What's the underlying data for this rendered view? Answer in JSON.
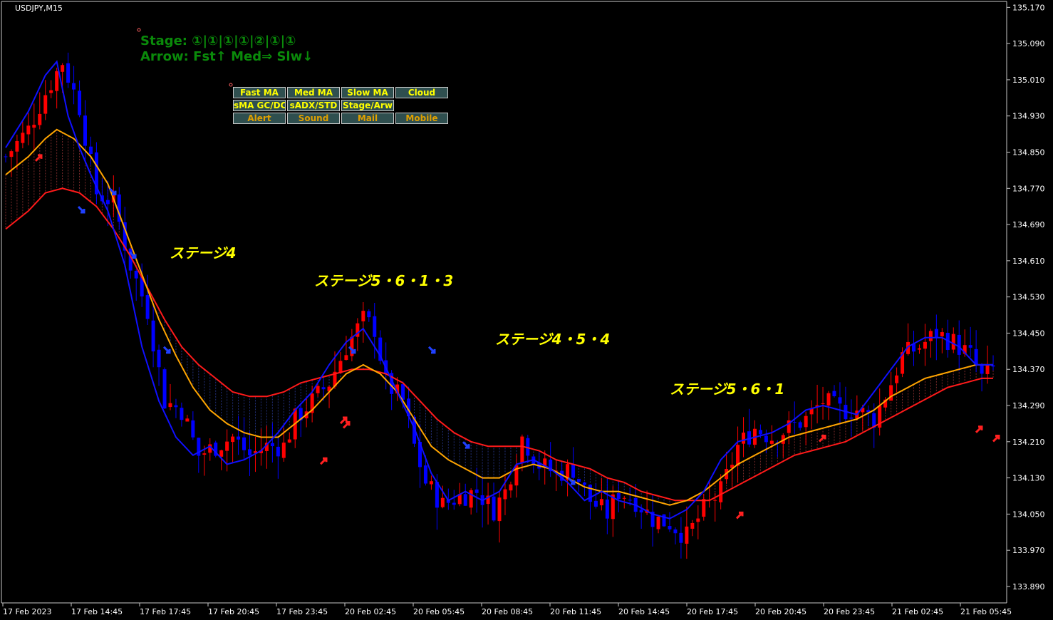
{
  "symbol_label": "USDJPY,M15",
  "status": {
    "stage_line": "Stage: ①|①|①|①|②|①|①",
    "arrow_line": "Arrow: Fst↑ Med⇒ Slw↓"
  },
  "buttons": {
    "row1": [
      "Fast MA",
      "Med MA",
      "Slow MA",
      "Cloud"
    ],
    "row2": [
      "sMA GC/DC",
      "sADX/STD",
      "Stage/Arw"
    ],
    "row3": [
      "Alert",
      "Sound",
      "Mail",
      "Mobile"
    ]
  },
  "annotations": [
    "ステージ4",
    "ステージ5・6・1・3",
    "ステージ4・5・4",
    "ステージ5・6・1"
  ],
  "colors": {
    "background": "#000000",
    "bull_candle": "#ff0000",
    "bear_candle": "#0000ff",
    "fast_ma": "#1010ff",
    "med_ma": "#ffa500",
    "slow_ma": "#ff1a1a",
    "annotation": "#ffff00",
    "status_text": "#0a8a0a",
    "button_bg": "#2f4f4f",
    "button_text": "#ffff00"
  },
  "chart_data": {
    "type": "candlestick",
    "symbol": "USDJPY",
    "timeframe": "M15",
    "ylim": [
      133.86,
      135.18
    ],
    "y_ticks": [
      "135.170",
      "135.090",
      "135.010",
      "134.930",
      "134.850",
      "134.770",
      "134.690",
      "134.610",
      "134.530",
      "134.450",
      "134.370",
      "134.290",
      "134.210",
      "134.130",
      "134.050",
      "133.970",
      "133.890"
    ],
    "x_ticks": [
      "17 Feb 2023",
      "17 Feb 14:45",
      "17 Feb 17:45",
      "17 Feb 20:45",
      "17 Feb 23:45",
      "20 Feb 02:45",
      "20 Feb 05:45",
      "20 Feb 08:45",
      "20 Feb 11:45",
      "20 Feb 14:45",
      "20 Feb 17:45",
      "20 Feb 20:45",
      "20 Feb 23:45",
      "21 Feb 02:45",
      "21 Feb 05:45"
    ],
    "close_path": [
      [
        0,
        134.84
      ],
      [
        4,
        134.9
      ],
      [
        7,
        134.98
      ],
      [
        10,
        135.05
      ],
      [
        13,
        134.95
      ],
      [
        16,
        134.76
      ],
      [
        19,
        134.74
      ],
      [
        22,
        134.6
      ],
      [
        25,
        134.5
      ],
      [
        28,
        134.3
      ],
      [
        31,
        134.28
      ],
      [
        34,
        134.18
      ],
      [
        37,
        134.2
      ],
      [
        40,
        134.22
      ],
      [
        43,
        134.18
      ],
      [
        46,
        134.2
      ],
      [
        49,
        134.2
      ],
      [
        51,
        134.26
      ],
      [
        54,
        134.3
      ],
      [
        57,
        134.34
      ],
      [
        60,
        134.42
      ],
      [
        63,
        134.48
      ],
      [
        65,
        134.46
      ],
      [
        67,
        134.34
      ],
      [
        70,
        134.3
      ],
      [
        72,
        134.2
      ],
      [
        74,
        134.12
      ],
      [
        77,
        134.07
      ],
      [
        80,
        134.09
      ],
      [
        83,
        134.1
      ],
      [
        86,
        134.06
      ],
      [
        88,
        134.1
      ],
      [
        91,
        134.22
      ],
      [
        94,
        134.16
      ],
      [
        97,
        134.14
      ],
      [
        100,
        134.15
      ],
      [
        103,
        134.08
      ],
      [
        106,
        134.05
      ],
      [
        108,
        134.1
      ],
      [
        111,
        134.08
      ],
      [
        114,
        134.04
      ],
      [
        117,
        134.03
      ],
      [
        120,
        134.0
      ],
      [
        123,
        134.06
      ],
      [
        126,
        134.1
      ],
      [
        129,
        134.2
      ],
      [
        132,
        134.24
      ],
      [
        135,
        134.22
      ],
      [
        138,
        134.24
      ],
      [
        141,
        134.26
      ],
      [
        144,
        134.3
      ],
      [
        147,
        134.28
      ],
      [
        150,
        134.28
      ],
      [
        153,
        134.26
      ],
      [
        156,
        134.34
      ],
      [
        158,
        134.4
      ],
      [
        161,
        134.42
      ],
      [
        164,
        134.45
      ],
      [
        167,
        134.43
      ],
      [
        170,
        134.4
      ],
      [
        172,
        134.35
      ],
      [
        174,
        134.37
      ]
    ],
    "ma_fast": [
      [
        0,
        134.86
      ],
      [
        4,
        134.94
      ],
      [
        7,
        135.02
      ],
      [
        9,
        135.05
      ],
      [
        11,
        134.93
      ],
      [
        13,
        134.86
      ],
      [
        15,
        134.8
      ],
      [
        18,
        134.72
      ],
      [
        21,
        134.6
      ],
      [
        24,
        134.42
      ],
      [
        27,
        134.3
      ],
      [
        30,
        134.22
      ],
      [
        33,
        134.18
      ],
      [
        36,
        134.2
      ],
      [
        39,
        134.16
      ],
      [
        42,
        134.17
      ],
      [
        45,
        134.19
      ],
      [
        48,
        134.23
      ],
      [
        51,
        134.28
      ],
      [
        54,
        134.32
      ],
      [
        57,
        134.38
      ],
      [
        60,
        134.43
      ],
      [
        63,
        134.46
      ],
      [
        66,
        134.4
      ],
      [
        69,
        134.32
      ],
      [
        72,
        134.24
      ],
      [
        75,
        134.14
      ],
      [
        78,
        134.08
      ],
      [
        81,
        134.1
      ],
      [
        84,
        134.08
      ],
      [
        87,
        134.1
      ],
      [
        90,
        134.16
      ],
      [
        93,
        134.17
      ],
      [
        96,
        134.15
      ],
      [
        99,
        134.12
      ],
      [
        102,
        134.08
      ],
      [
        105,
        134.1
      ],
      [
        108,
        134.08
      ],
      [
        111,
        134.07
      ],
      [
        114,
        134.05
      ],
      [
        117,
        134.04
      ],
      [
        120,
        134.06
      ],
      [
        123,
        134.1
      ],
      [
        126,
        134.17
      ],
      [
        129,
        134.21
      ],
      [
        132,
        134.22
      ],
      [
        135,
        134.23
      ],
      [
        138,
        134.25
      ],
      [
        141,
        134.28
      ],
      [
        144,
        134.29
      ],
      [
        147,
        134.28
      ],
      [
        150,
        134.27
      ],
      [
        153,
        134.32
      ],
      [
        156,
        134.37
      ],
      [
        159,
        134.42
      ],
      [
        162,
        134.44
      ],
      [
        165,
        134.44
      ],
      [
        168,
        134.42
      ],
      [
        171,
        134.38
      ],
      [
        174,
        134.38
      ]
    ],
    "ma_med": [
      [
        0,
        134.8
      ],
      [
        4,
        134.84
      ],
      [
        7,
        134.88
      ],
      [
        9,
        134.9
      ],
      [
        12,
        134.88
      ],
      [
        15,
        134.84
      ],
      [
        18,
        134.78
      ],
      [
        21,
        134.68
      ],
      [
        24,
        134.58
      ],
      [
        27,
        134.48
      ],
      [
        30,
        134.4
      ],
      [
        33,
        134.33
      ],
      [
        36,
        134.28
      ],
      [
        39,
        134.25
      ],
      [
        42,
        134.23
      ],
      [
        45,
        134.22
      ],
      [
        48,
        134.22
      ],
      [
        51,
        134.25
      ],
      [
        54,
        134.28
      ],
      [
        57,
        134.32
      ],
      [
        60,
        134.36
      ],
      [
        63,
        134.38
      ],
      [
        66,
        134.36
      ],
      [
        69,
        134.32
      ],
      [
        72,
        134.26
      ],
      [
        75,
        134.2
      ],
      [
        78,
        134.17
      ],
      [
        81,
        134.15
      ],
      [
        84,
        134.13
      ],
      [
        87,
        134.13
      ],
      [
        90,
        134.15
      ],
      [
        93,
        134.16
      ],
      [
        96,
        134.15
      ],
      [
        99,
        134.13
      ],
      [
        102,
        134.11
      ],
      [
        105,
        134.1
      ],
      [
        108,
        134.1
      ],
      [
        111,
        134.09
      ],
      [
        114,
        134.08
      ],
      [
        117,
        134.07
      ],
      [
        120,
        134.08
      ],
      [
        123,
        134.1
      ],
      [
        126,
        134.13
      ],
      [
        129,
        134.16
      ],
      [
        132,
        134.18
      ],
      [
        135,
        134.2
      ],
      [
        138,
        134.22
      ],
      [
        141,
        134.23
      ],
      [
        144,
        134.24
      ],
      [
        147,
        134.25
      ],
      [
        150,
        134.26
      ],
      [
        153,
        134.28
      ],
      [
        156,
        134.31
      ],
      [
        159,
        134.33
      ],
      [
        162,
        134.35
      ],
      [
        165,
        134.36
      ],
      [
        168,
        134.37
      ],
      [
        171,
        134.38
      ],
      [
        174,
        134.38
      ]
    ],
    "ma_slow": [
      [
        0,
        134.68
      ],
      [
        4,
        134.72
      ],
      [
        7,
        134.76
      ],
      [
        10,
        134.77
      ],
      [
        13,
        134.76
      ],
      [
        16,
        134.73
      ],
      [
        19,
        134.68
      ],
      [
        22,
        134.62
      ],
      [
        25,
        134.55
      ],
      [
        28,
        134.48
      ],
      [
        31,
        134.42
      ],
      [
        34,
        134.38
      ],
      [
        37,
        134.35
      ],
      [
        40,
        134.32
      ],
      [
        43,
        134.31
      ],
      [
        46,
        134.31
      ],
      [
        49,
        134.32
      ],
      [
        52,
        134.34
      ],
      [
        55,
        134.35
      ],
      [
        58,
        134.36
      ],
      [
        61,
        134.37
      ],
      [
        64,
        134.37
      ],
      [
        67,
        134.36
      ],
      [
        70,
        134.34
      ],
      [
        73,
        134.3
      ],
      [
        76,
        134.26
      ],
      [
        79,
        134.23
      ],
      [
        82,
        134.21
      ],
      [
        85,
        134.2
      ],
      [
        88,
        134.2
      ],
      [
        91,
        134.2
      ],
      [
        94,
        134.19
      ],
      [
        97,
        134.17
      ],
      [
        100,
        134.16
      ],
      [
        103,
        134.15
      ],
      [
        106,
        134.13
      ],
      [
        109,
        134.12
      ],
      [
        112,
        134.1
      ],
      [
        115,
        134.09
      ],
      [
        118,
        134.08
      ],
      [
        121,
        134.08
      ],
      [
        124,
        134.08
      ],
      [
        127,
        134.1
      ],
      [
        130,
        134.12
      ],
      [
        133,
        134.14
      ],
      [
        136,
        134.16
      ],
      [
        139,
        134.18
      ],
      [
        142,
        134.19
      ],
      [
        145,
        134.2
      ],
      [
        148,
        134.21
      ],
      [
        151,
        134.23
      ],
      [
        154,
        134.25
      ],
      [
        157,
        134.27
      ],
      [
        160,
        134.29
      ],
      [
        163,
        134.31
      ],
      [
        166,
        134.33
      ],
      [
        169,
        134.34
      ],
      [
        172,
        134.35
      ],
      [
        174,
        134.35
      ]
    ]
  }
}
